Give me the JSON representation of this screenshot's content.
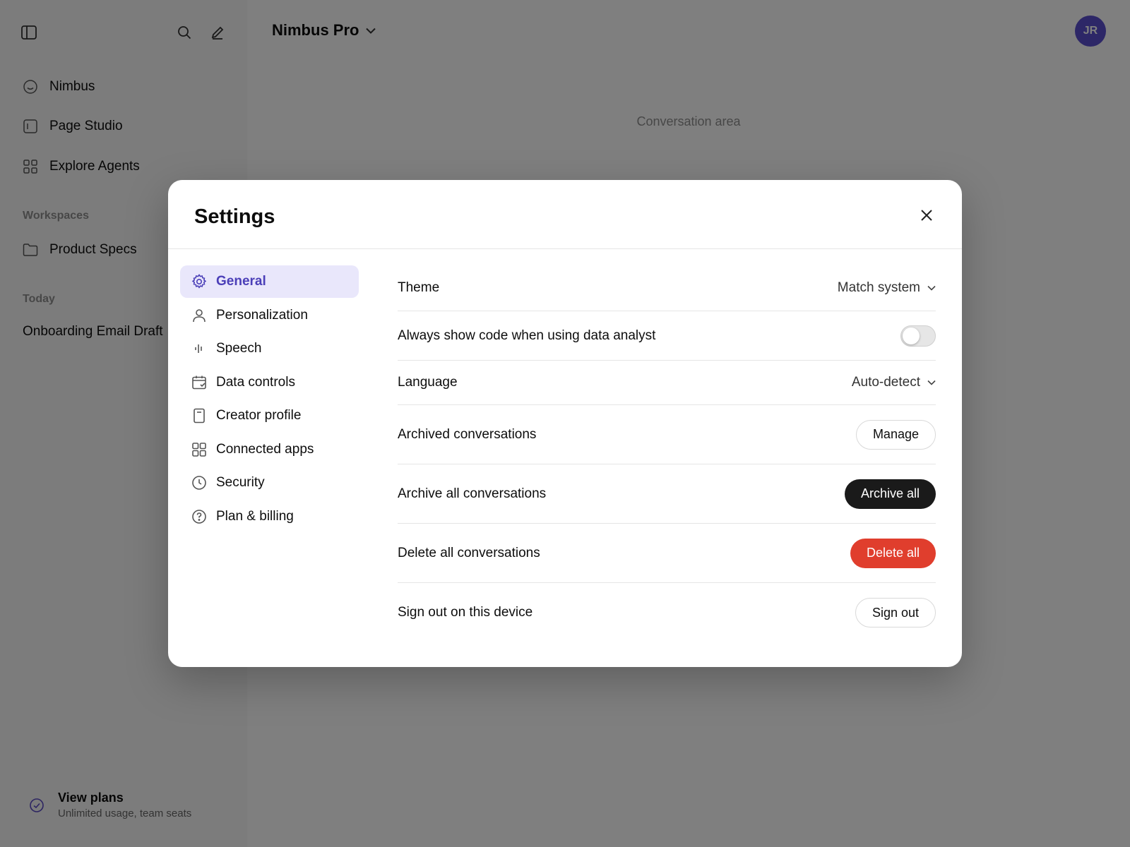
{
  "sidebar": {
    "nav": [
      {
        "label": "Nimbus",
        "icon": "smile-icon"
      },
      {
        "label": "Page Studio",
        "icon": "page-icon"
      },
      {
        "label": "Explore Agents",
        "icon": "grid-icon"
      }
    ],
    "workspaces_heading": "Workspaces",
    "workspace": {
      "label": "Product Specs",
      "icon": "folder-icon"
    },
    "today_heading": "Today",
    "chat": "Onboarding Email Draft",
    "plans": {
      "title": "View plans",
      "subtitle": "Unlimited usage, team seats"
    }
  },
  "header": {
    "model_name": "Nimbus Pro",
    "avatar_initials": "JR"
  },
  "main": {
    "placeholder": "Conversation area"
  },
  "settings": {
    "title": "Settings",
    "tabs": [
      {
        "label": "General",
        "icon": "gear-icon",
        "active": true
      },
      {
        "label": "Personalization",
        "icon": "person-icon"
      },
      {
        "label": "Speech",
        "icon": "waveform-icon"
      },
      {
        "label": "Data controls",
        "icon": "calendar-icon"
      },
      {
        "label": "Creator profile",
        "icon": "document-icon"
      },
      {
        "label": "Connected apps",
        "icon": "apps-grid-icon"
      },
      {
        "label": "Security",
        "icon": "clock-icon"
      },
      {
        "label": "Plan & billing",
        "icon": "help-circle-icon"
      }
    ],
    "rows": {
      "theme": {
        "label": "Theme",
        "value": "Match system"
      },
      "show_code": {
        "label": "Always show code when using data analyst",
        "enabled": false
      },
      "language": {
        "label": "Language",
        "value": "Auto-detect"
      },
      "archived": {
        "label": "Archived conversations",
        "button": "Manage"
      },
      "archive_all": {
        "label": "Archive all conversations",
        "button": "Archive all"
      },
      "delete_all": {
        "label": "Delete all conversations",
        "button": "Delete all"
      },
      "sign_out": {
        "label": "Sign out on this device",
        "button": "Sign out"
      }
    }
  },
  "colors": {
    "accent": "#5a4fcf",
    "danger": "#e03e2d",
    "dark_button": "#1a1a1a"
  }
}
